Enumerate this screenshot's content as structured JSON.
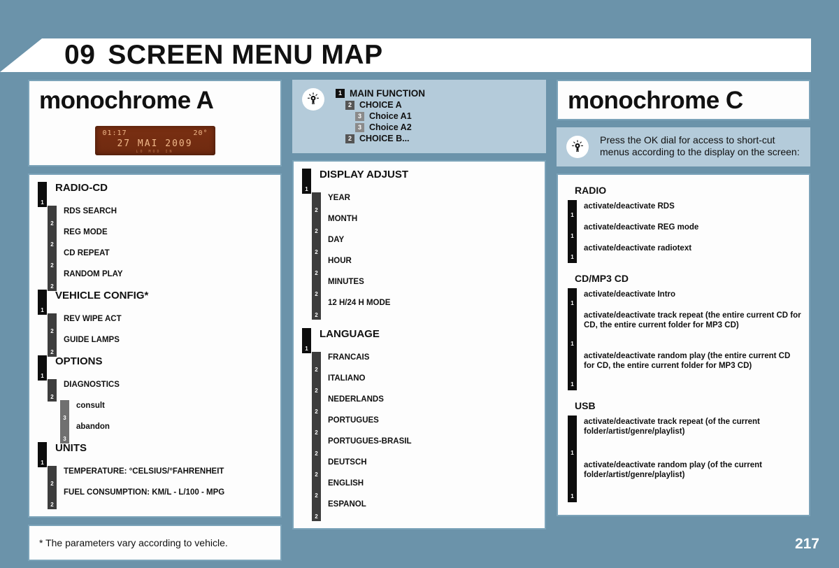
{
  "header": {
    "chapter_number": "09",
    "title": "SCREEN MENU MAP"
  },
  "page_number": "217",
  "colors": {
    "page_background": "#6b93aa",
    "card_border": "#7ba3b9",
    "legend_background": "#b4cbda",
    "level1_badge": "#0d0d0d",
    "level2_badge": "#3d3d3d",
    "level3_badge": "#707070",
    "lcd_background": "#7a2f12",
    "lcd_text": "#f0b88a"
  },
  "left_column": {
    "title": "monochrome A",
    "lcd_display": {
      "time": "01:17",
      "temperature": "20°",
      "date": "27 MAI 2009",
      "sub_indicators": "LO    MOD IN"
    },
    "tree": [
      {
        "level": 1,
        "label": "RADIO-CD"
      },
      {
        "level": 2,
        "label": "RDS SEARCH"
      },
      {
        "level": 2,
        "label": "REG MODE"
      },
      {
        "level": 2,
        "label": "CD REPEAT"
      },
      {
        "level": 2,
        "label": "RANDOM PLAY"
      },
      {
        "level": 1,
        "label": "VEHICLE CONFIG*"
      },
      {
        "level": 2,
        "label": "REV WIPE ACT"
      },
      {
        "level": 2,
        "label": "GUIDE LAMPS"
      },
      {
        "level": 1,
        "label": "OPTIONS"
      },
      {
        "level": 2,
        "label": "DIAGNOSTICS"
      },
      {
        "level": 3,
        "label": "consult"
      },
      {
        "level": 3,
        "label": "abandon"
      },
      {
        "level": 1,
        "label": "UNITS"
      },
      {
        "level": 2,
        "label": "TEMPERATURE: °CELSIUS/°FAHRENHEIT"
      },
      {
        "level": 2,
        "label": "FUEL CONSUMPTION: KM/L - L/100 - MPG"
      }
    ],
    "footnote": "* The parameters vary according to vehicle."
  },
  "middle_column": {
    "legend": {
      "icon": "lightbulb-icon",
      "rows": [
        {
          "level": 1,
          "label": "MAIN FUNCTION"
        },
        {
          "level": 2,
          "label": "CHOICE A"
        },
        {
          "level": 3,
          "label": "Choice A1"
        },
        {
          "level": 3,
          "label": "Choice A2"
        },
        {
          "level": 2,
          "label": "CHOICE B..."
        }
      ]
    },
    "tree": [
      {
        "level": 1,
        "label": "DISPLAY ADJUST"
      },
      {
        "level": 2,
        "label": "YEAR"
      },
      {
        "level": 2,
        "label": "MONTH"
      },
      {
        "level": 2,
        "label": "DAY"
      },
      {
        "level": 2,
        "label": "HOUR"
      },
      {
        "level": 2,
        "label": "MINUTES"
      },
      {
        "level": 2,
        "label": "12 H/24 H MODE"
      },
      {
        "level": 0,
        "label": ""
      },
      {
        "level": 1,
        "label": "LANGUAGE"
      },
      {
        "level": 2,
        "label": "FRANCAIS"
      },
      {
        "level": 2,
        "label": "ITALIANO"
      },
      {
        "level": 2,
        "label": "NEDERLANDS"
      },
      {
        "level": 2,
        "label": "PORTUGUES"
      },
      {
        "level": 2,
        "label": "PORTUGUES-BRASIL"
      },
      {
        "level": 2,
        "label": "DEUTSCH"
      },
      {
        "level": 2,
        "label": "ENGLISH"
      },
      {
        "level": 2,
        "label": "ESPANOL"
      }
    ]
  },
  "right_column": {
    "title": "monochrome C",
    "note": {
      "icon": "lightbulb-icon",
      "text": "Press the OK dial for access to short-cut menus according to the display on the screen:"
    },
    "groups": [
      {
        "heading": "RADIO",
        "items": [
          {
            "badge": "1",
            "size": "h1",
            "label": "activate/deactivate RDS"
          },
          {
            "badge": "1",
            "size": "h1",
            "label": "activate/deactivate REG mode"
          },
          {
            "badge": "1",
            "size": "h1",
            "label": "activate/deactivate radiotext"
          }
        ]
      },
      {
        "heading": "CD/MP3 CD",
        "items": [
          {
            "badge": "1",
            "size": "h1",
            "label": "activate/deactivate Intro"
          },
          {
            "badge": "1",
            "size": "h2",
            "label": "activate/deactivate track repeat (the entire current CD for CD, the entire current folder for MP3 CD)"
          },
          {
            "badge": "1",
            "size": "h2",
            "label": "activate/deactivate random play (the entire current CD for CD, the entire current folder for MP3 CD)"
          }
        ]
      },
      {
        "heading": "USB",
        "items": [
          {
            "badge": "1",
            "size": "h3",
            "label": "activate/deactivate track repeat (of the current folder/artist/genre/playlist)"
          },
          {
            "badge": "1",
            "size": "h3",
            "label": "activate/deactivate random play (of the current folder/artist/genre/playlist)"
          }
        ]
      }
    ]
  }
}
